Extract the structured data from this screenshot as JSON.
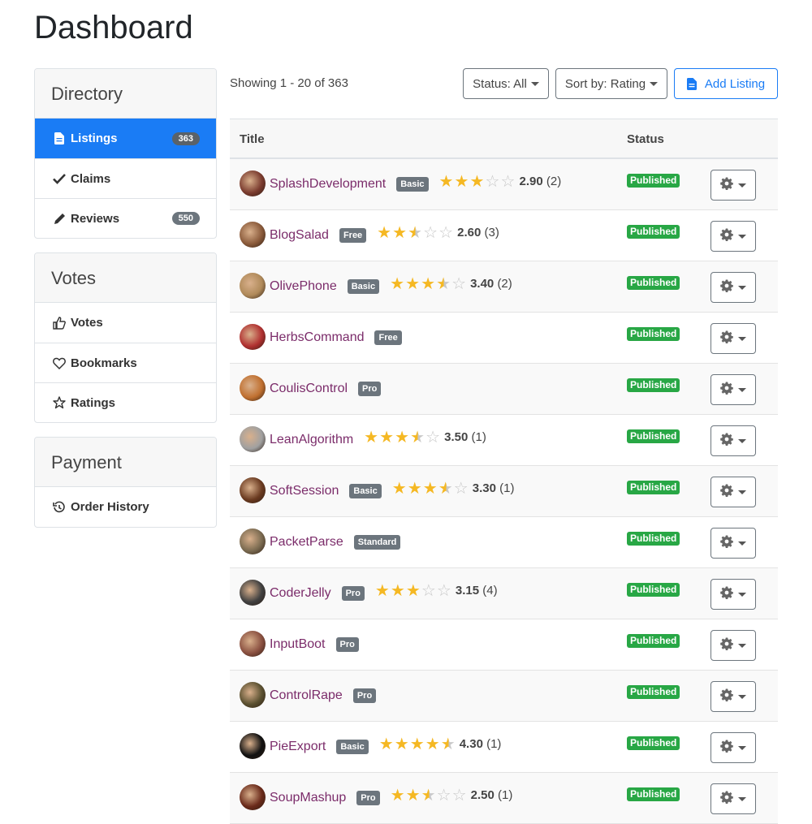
{
  "page_title": "Dashboard",
  "sidebar": {
    "panels": [
      {
        "title": "Directory",
        "items": [
          {
            "label": "Listings",
            "icon": "file-icon",
            "badge": "363",
            "active": true
          },
          {
            "label": "Claims",
            "icon": "check-icon",
            "badge": null,
            "active": false
          },
          {
            "label": "Reviews",
            "icon": "pencil-icon",
            "badge": "550",
            "active": false
          }
        ]
      },
      {
        "title": "Votes",
        "items": [
          {
            "label": "Votes",
            "icon": "thumbs-up-icon",
            "badge": null,
            "active": false
          },
          {
            "label": "Bookmarks",
            "icon": "heart-icon",
            "badge": null,
            "active": false
          },
          {
            "label": "Ratings",
            "icon": "star-icon",
            "badge": null,
            "active": false
          }
        ]
      },
      {
        "title": "Payment",
        "items": [
          {
            "label": "Order History",
            "icon": "history-icon",
            "badge": null,
            "active": false
          }
        ]
      }
    ]
  },
  "toolbar": {
    "showing": "Showing 1 - 20 of 363",
    "status_filter": "Status: All",
    "sort": "Sort by: Rating",
    "add_listing": "Add Listing"
  },
  "table": {
    "headers": {
      "title": "Title",
      "status": "Status"
    },
    "rows": [
      {
        "title": "SplashDevelopment",
        "plan": "Basic",
        "rating": 2.9,
        "score": "2.90",
        "count": "(2)",
        "status": "Published",
        "avatar_color": "#7a3b2e"
      },
      {
        "title": "BlogSalad",
        "plan": "Free",
        "rating": 2.6,
        "score": "2.60",
        "count": "(3)",
        "status": "Published",
        "avatar_color": "#8a5a3a"
      },
      {
        "title": "OlivePhone",
        "plan": "Basic",
        "rating": 3.4,
        "score": "3.40",
        "count": "(2)",
        "status": "Published",
        "avatar_color": "#b08a5a"
      },
      {
        "title": "HerbsCommand",
        "plan": "Free",
        "rating": null,
        "score": "",
        "count": "",
        "status": "Published",
        "avatar_color": "#b03030"
      },
      {
        "title": "CoulisControl",
        "plan": "Pro",
        "rating": null,
        "score": "",
        "count": "",
        "status": "Published",
        "avatar_color": "#c07030"
      },
      {
        "title": "LeanAlgorithm",
        "plan": "",
        "rating": 3.5,
        "score": "3.50",
        "count": "(1)",
        "status": "Published",
        "avatar_color": "#a0a0a0"
      },
      {
        "title": "SoftSession",
        "plan": "Basic",
        "rating": 3.3,
        "score": "3.30",
        "count": "(1)",
        "status": "Published",
        "avatar_color": "#6a3a20"
      },
      {
        "title": "PacketParse",
        "plan": "Standard",
        "rating": null,
        "score": "",
        "count": "",
        "status": "Published",
        "avatar_color": "#7a6a50"
      },
      {
        "title": "CoderJelly",
        "plan": "Pro",
        "rating": 3.15,
        "score": "3.15",
        "count": "(4)",
        "status": "Published",
        "avatar_color": "#404040"
      },
      {
        "title": "InputBoot",
        "plan": "Pro",
        "rating": null,
        "score": "",
        "count": "",
        "status": "Published",
        "avatar_color": "#8a5040"
      },
      {
        "title": "ControlRape",
        "plan": "Pro",
        "rating": null,
        "score": "",
        "count": "",
        "status": "Published",
        "avatar_color": "#5a5030"
      },
      {
        "title": "PieExport",
        "plan": "Basic",
        "rating": 4.3,
        "score": "4.30",
        "count": "(1)",
        "status": "Published",
        "avatar_color": "#111111"
      },
      {
        "title": "SoupMashup",
        "plan": "Pro",
        "rating": 2.5,
        "score": "2.50",
        "count": "(1)",
        "status": "Published",
        "avatar_color": "#6a2a1a"
      }
    ]
  },
  "colors": {
    "accent": "#1a7cf5",
    "published": "#28a745",
    "star": "#f5b823",
    "link": "#7b2c6a"
  }
}
